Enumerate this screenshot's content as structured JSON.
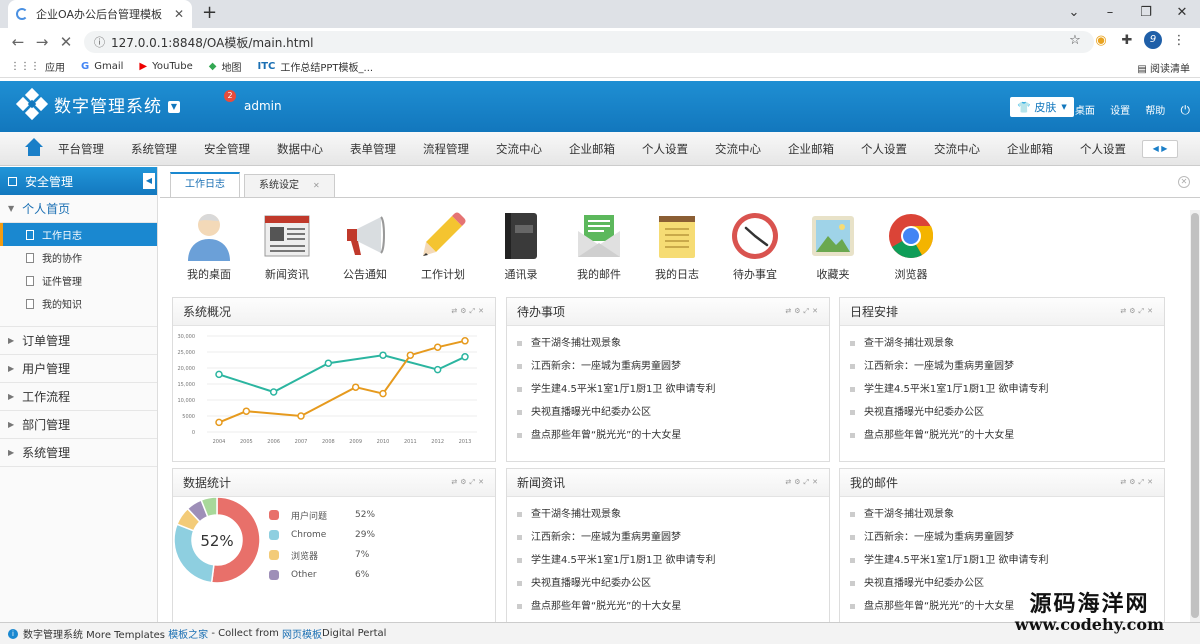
{
  "browser": {
    "tab_title": "企业OA办公后台管理模板",
    "tab_close": "✕",
    "new_tab": "+",
    "url": "127.0.0.1:8848/OA模板/main.html",
    "profile_initial": "9",
    "bookmarks": [
      "应用",
      "Gmail",
      "YouTube",
      "地图",
      "工作总结PPT模板_..."
    ],
    "reading_list": "阅读清单"
  },
  "header": {
    "title": "数字管理系统",
    "user": "admin",
    "badge_count": "2",
    "skin_label": "皮肤",
    "links": [
      "桌面",
      "设置",
      "帮助"
    ]
  },
  "topnav": {
    "items": [
      "平台管理",
      "系统管理",
      "安全管理",
      "数据中心",
      "表单管理",
      "流程管理",
      "交流中心",
      "企业邮箱",
      "个人设置",
      "交流中心",
      "企业邮箱",
      "个人设置",
      "交流中心",
      "企业邮箱",
      "个人设置"
    ]
  },
  "sidebar": {
    "header": "安全管理",
    "open_group": "个人首页",
    "sub_items": [
      "工作日志",
      "我的协作",
      "证件管理",
      "我的知识"
    ],
    "groups": [
      "订单管理",
      "用户管理",
      "工作流程",
      "部门管理",
      "系统管理"
    ]
  },
  "tabs": [
    "工作日志",
    "系统设定"
  ],
  "apps": [
    "我的桌面",
    "新闻资讯",
    "公告通知",
    "工作计划",
    "通讯录",
    "我的邮件",
    "我的日志",
    "待办事宜",
    "收藏夹",
    "浏览器"
  ],
  "panels": {
    "overview": {
      "title": "系统概况"
    },
    "todo": {
      "title": "待办事项",
      "items": [
        "查干湖冬捕壮观景象",
        "江西新余：一座城为重病男童圆梦",
        "学生建4.5平米1室1厅1厨1卫 欲申请专利",
        "央视直播曝光中纪委办公区",
        "盘点那些年曾“脱光光”的十大女星"
      ]
    },
    "schedule": {
      "title": "日程安排",
      "items": [
        "查干湖冬捕壮观景象",
        "江西新余：一座城为重病男童圆梦",
        "学生建4.5平米1室1厅1厨1卫 欲申请专利",
        "央视直播曝光中纪委办公区",
        "盘点那些年曾“脱光光”的十大女星"
      ]
    },
    "stats": {
      "title": "数据统计"
    },
    "news": {
      "title": "新闻资讯",
      "items": [
        "查干湖冬捕壮观景象",
        "江西新余：一座城为重病男童圆梦",
        "学生建4.5平米1室1厅1厨1卫 欲申请专利",
        "央视直播曝光中纪委办公区",
        "盘点那些年曾“脱光光”的十大女星"
      ]
    },
    "mail": {
      "title": "我的邮件",
      "items": [
        "查干湖冬捕壮观景象",
        "江西新余：一座城为重病男童圆梦",
        "学生建4.5平米1室1厅1厨1卫 欲申请专利",
        "央视直播曝光中纪委办公区",
        "盘点那些年曾“脱光光”的十大女星"
      ]
    }
  },
  "chart_data": [
    {
      "type": "line",
      "title": "",
      "x": [
        "2004",
        "2005",
        "2006",
        "2007",
        "2008",
        "2009",
        "2010",
        "2011",
        "2012",
        "2013"
      ],
      "ylim": [
        0,
        30000
      ],
      "yticks": [
        "0",
        "5000",
        "10,000",
        "15,000",
        "20,000",
        "25,000",
        "30,000"
      ],
      "series": [
        {
          "values": [
            18000,
            null,
            12500,
            null,
            21500,
            null,
            24000,
            null,
            19500,
            23500
          ],
          "color": "#2bb5a0"
        },
        {
          "values": [
            3000,
            6500,
            null,
            5000,
            null,
            14000,
            12000,
            24000,
            26500,
            28500
          ],
          "color": "#e69a1e"
        }
      ]
    },
    {
      "type": "pie",
      "center_label": "52%",
      "slices": [
        {
          "label": "用户问题",
          "value": 52,
          "display": "52%",
          "color": "#e8706a"
        },
        {
          "label": "Chrome",
          "value": 29,
          "display": "29%",
          "color": "#8ecfe0"
        },
        {
          "label": "浏览器",
          "value": 7,
          "display": "7%",
          "color": "#f3cb78"
        },
        {
          "label": "Other",
          "value": 6,
          "display": "6%",
          "color": "#9e8fb8"
        },
        {
          "value": 6,
          "color": "#a8d89a"
        }
      ]
    }
  ],
  "statusbar": {
    "prefix": "数字管理系统 More Templates ",
    "link1": "模板之家",
    "mid": " - Collect from ",
    "link2": "网页模板",
    "suffix": "Digital Pertal"
  },
  "watermark": {
    "line1": "源码海洋网",
    "line2": "www.codehy.com"
  }
}
